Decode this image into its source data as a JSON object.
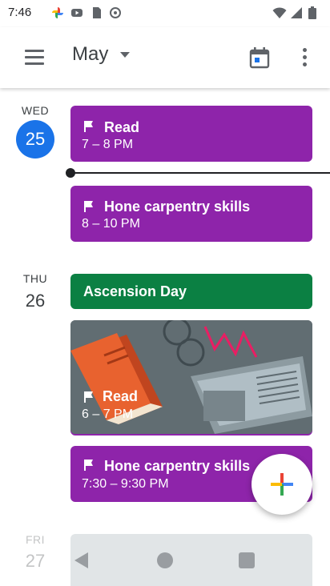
{
  "status_bar": {
    "time": "7:46"
  },
  "app_bar": {
    "month": "May"
  },
  "days": [
    {
      "dow": "WED",
      "date": "25"
    },
    {
      "dow": "THU",
      "date": "26"
    },
    {
      "dow": "FRI",
      "date": "27"
    }
  ],
  "events": [
    {
      "title": "Read",
      "time": "7 – 8 PM"
    },
    {
      "title": "Hone carpentry skills",
      "time": "8 – 10 PM"
    },
    {
      "title": "Ascension Day"
    },
    {
      "title": "Read",
      "time": "6 – 7 PM"
    },
    {
      "title": "Hone carpentry skills",
      "time": "7:30 – 9:30 PM"
    }
  ],
  "colors": {
    "event": "#8e24aa",
    "holiday": "#0b8043",
    "today": "#1a73e8",
    "fab_accent": "#4285f4"
  },
  "icons": [
    "menu-icon",
    "chevron-down-icon",
    "calendar-today-icon",
    "more-vert-icon",
    "flag-icon",
    "add-icon",
    "back-icon",
    "home-icon",
    "recents-icon"
  ]
}
